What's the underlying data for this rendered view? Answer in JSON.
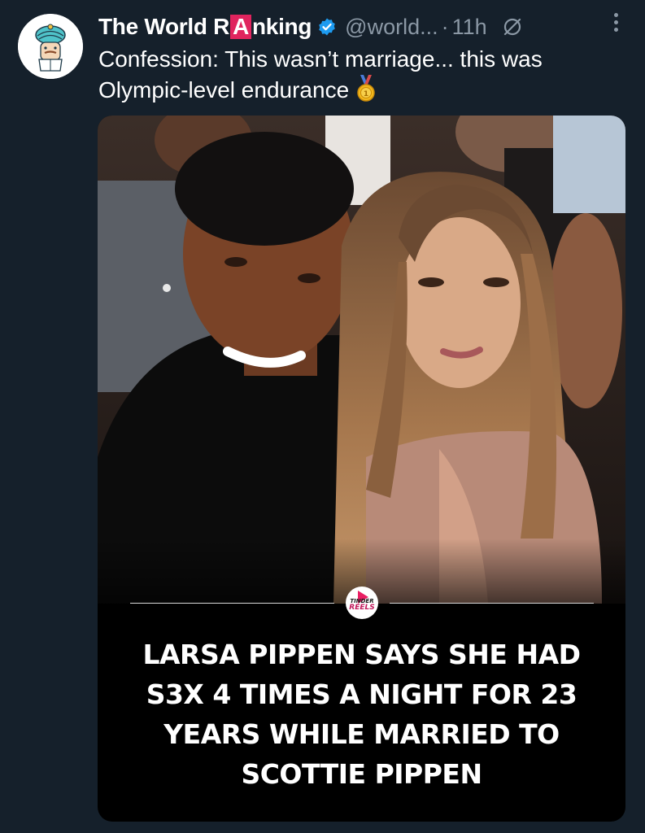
{
  "tweet": {
    "display_name_before": "The World R",
    "display_name_boxed": "A",
    "display_name_after": "nking",
    "handle": "@world...",
    "separator": "·",
    "time": "11h",
    "text": "Confession: This wasn’t marriage... this was Olympic-level endurance",
    "text_emoji": "medal-icon"
  },
  "media": {
    "logo_top": "TINDER",
    "logo_bottom": "REELS",
    "headline_lines": [
      "LARSA PIPPEN SAYS SHE HAD",
      "S3X 4 TIMES A NIGHT FOR 23",
      "YEARS WHILE MARRIED TO",
      "SCOTTIE PIPPEN"
    ]
  },
  "icons": {
    "avatar": "turban-character-avatar",
    "verified": "verified-badge-icon",
    "grok": "grok-icon",
    "more": "more-options-icon",
    "medal": "medal-icon"
  },
  "colors": {
    "background": "#15202b",
    "secondary_text": "#8b98a5",
    "verified_blue": "#1d9bf0",
    "name_box_red": "#e0245e",
    "media_background": "#000000"
  }
}
